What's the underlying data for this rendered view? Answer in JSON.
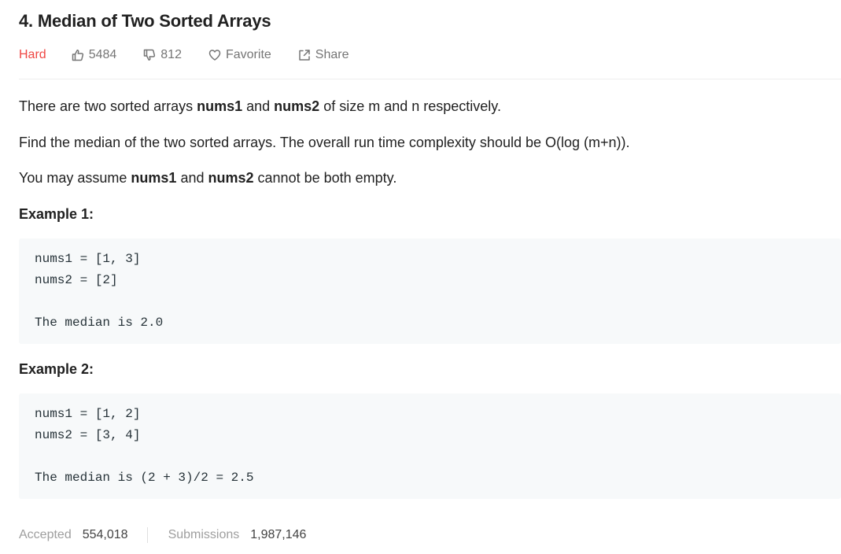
{
  "problem": {
    "title": "4. Median of Two Sorted Arrays",
    "difficulty": "Hard",
    "likes": "5484",
    "dislikes": "812",
    "favorite_label": "Favorite",
    "share_label": "Share"
  },
  "description": {
    "p1": {
      "before": "There are two sorted arrays ",
      "kw1": "nums1",
      "mid": " and ",
      "kw2": "nums2",
      "after": " of size m and n respectively."
    },
    "p2": "Find the median of the two sorted arrays. The overall run time complexity should be O(log (m+n)).",
    "p3": {
      "before": "You may assume ",
      "kw1": "nums1",
      "mid": " and ",
      "kw2": "nums2",
      "after": " cannot be both empty."
    }
  },
  "examples": [
    {
      "heading": "Example 1:",
      "line1": "nums1 = [1, 3]",
      "line2": "nums2 = [2]",
      "result": "The median is 2.0"
    },
    {
      "heading": "Example 2:",
      "line1": "nums1 = [1, 2]",
      "line2": "nums2 = [3, 4]",
      "result": "The median is (2 + 3)/2 = 2.5"
    }
  ],
  "stats": {
    "accepted_label": "Accepted",
    "accepted_value": "554,018",
    "submissions_label": "Submissions",
    "submissions_value": "1,987,146"
  },
  "colors": {
    "difficulty_hard": "#ef4743",
    "muted": "#757575",
    "code_bg": "#f7f9fa"
  },
  "icons": {
    "likes": "thumbs-up-icon",
    "dislikes": "thumbs-down-icon",
    "favorite": "heart-icon",
    "share": "share-icon"
  }
}
